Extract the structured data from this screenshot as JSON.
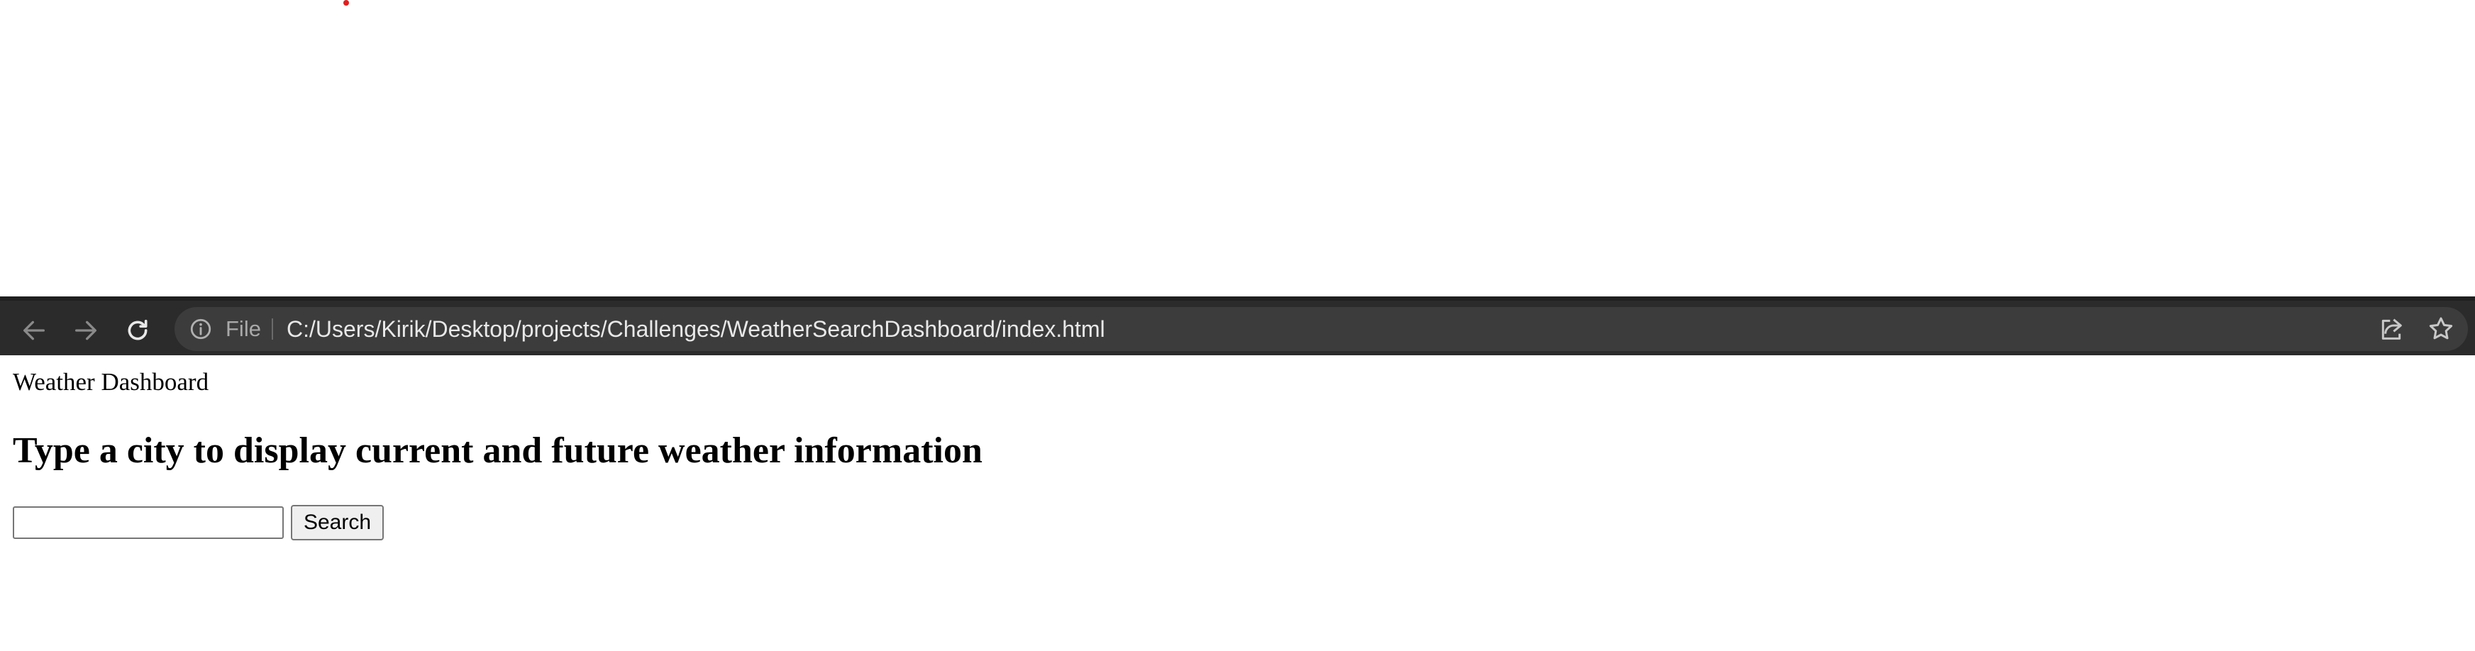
{
  "browser": {
    "scheme_label": "File",
    "url": "C:/Users/Kirik/Desktop/projects/Challenges/WeatherSearchDashboard/index.html"
  },
  "page": {
    "header_title": "Weather Dashboard",
    "heading": "Type a city to display current and future weather information",
    "search": {
      "value": "",
      "placeholder": "",
      "button_label": "Search"
    }
  },
  "icons": {
    "back": "arrow-left-icon",
    "forward": "arrow-right-icon",
    "reload": "reload-icon",
    "info": "info-icon",
    "share": "share-icon",
    "bookmark": "star-icon"
  },
  "colors": {
    "toolbar_bg": "#2b2b2b",
    "omnibox_bg": "#3c3c3c",
    "url_text": "#e8e8e8",
    "scheme_text": "#a9a9a9",
    "cursor_dot": "#e02020"
  }
}
